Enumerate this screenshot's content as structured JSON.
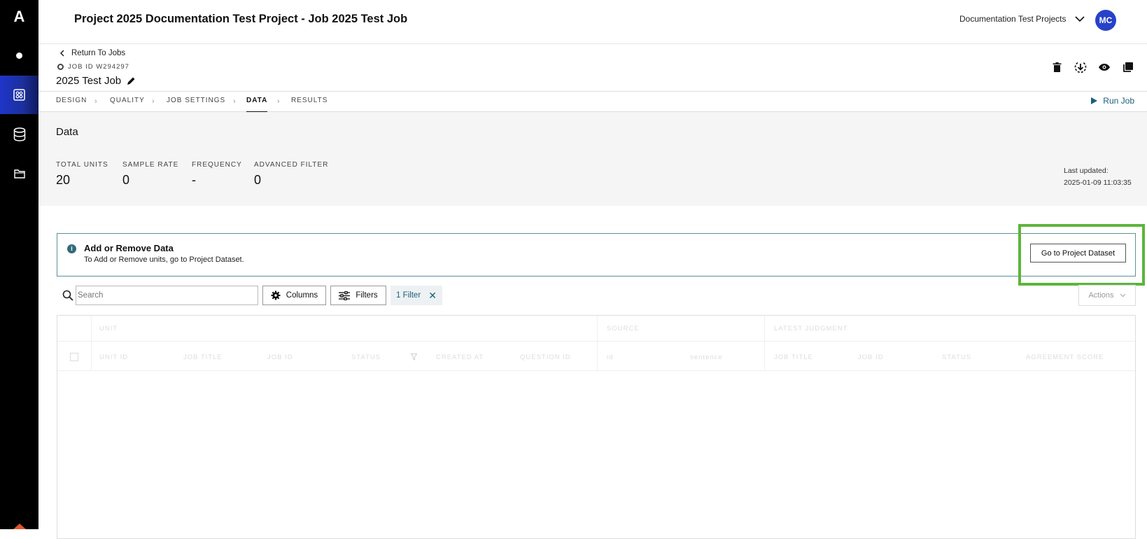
{
  "header": {
    "title": "Project 2025 Documentation Test Project - Job 2025 Test Job",
    "project_select": "Documentation Test Projects",
    "avatar_initials": "MC"
  },
  "subheader": {
    "return_label": "Return To Jobs",
    "job_id_label": "JOB ID W294297",
    "job_name": "2025 Test Job"
  },
  "tabs": [
    {
      "label": "DESIGN"
    },
    {
      "label": "QUALITY"
    },
    {
      "label": "JOB SETTINGS"
    },
    {
      "label": "DATA",
      "active": true
    },
    {
      "label": "RESULTS"
    }
  ],
  "run_job_label": "Run Job",
  "summary": {
    "title": "Data",
    "stats": [
      {
        "label": "TOTAL UNITS",
        "value": "20"
      },
      {
        "label": "SAMPLE RATE",
        "value": "0"
      },
      {
        "label": "FREQUENCY",
        "value": "-"
      },
      {
        "label": "ADVANCED FILTER",
        "value": "0"
      }
    ],
    "last_updated_label": "Last updated:",
    "last_updated_value": "2025-01-09 11:03:35"
  },
  "info": {
    "title": "Add or Remove Data",
    "text": "To Add or Remove units, go to Project Dataset.",
    "button": "Go to Project Dataset"
  },
  "toolbar": {
    "search_placeholder": "Search",
    "columns_label": "Columns",
    "filters_label": "Filters",
    "filter_chip": "1 Filter",
    "actions_label": "Actions"
  },
  "table": {
    "groups": [
      "UNIT",
      "SOURCE",
      "LATEST JUDGMENT"
    ],
    "columns": [
      "UNIT ID",
      "JOB TITLE",
      "JOB ID",
      "STATUS",
      "CREATED AT",
      "QUESTION ID",
      "id",
      "sentence",
      "JOB TITLE",
      "JOB ID",
      "STATUS",
      "AGREEMENT SCORE"
    ]
  },
  "colors": {
    "accent": "#1b5e7a",
    "active_nav": "#1f35c9",
    "highlight": "#5cb53c"
  }
}
